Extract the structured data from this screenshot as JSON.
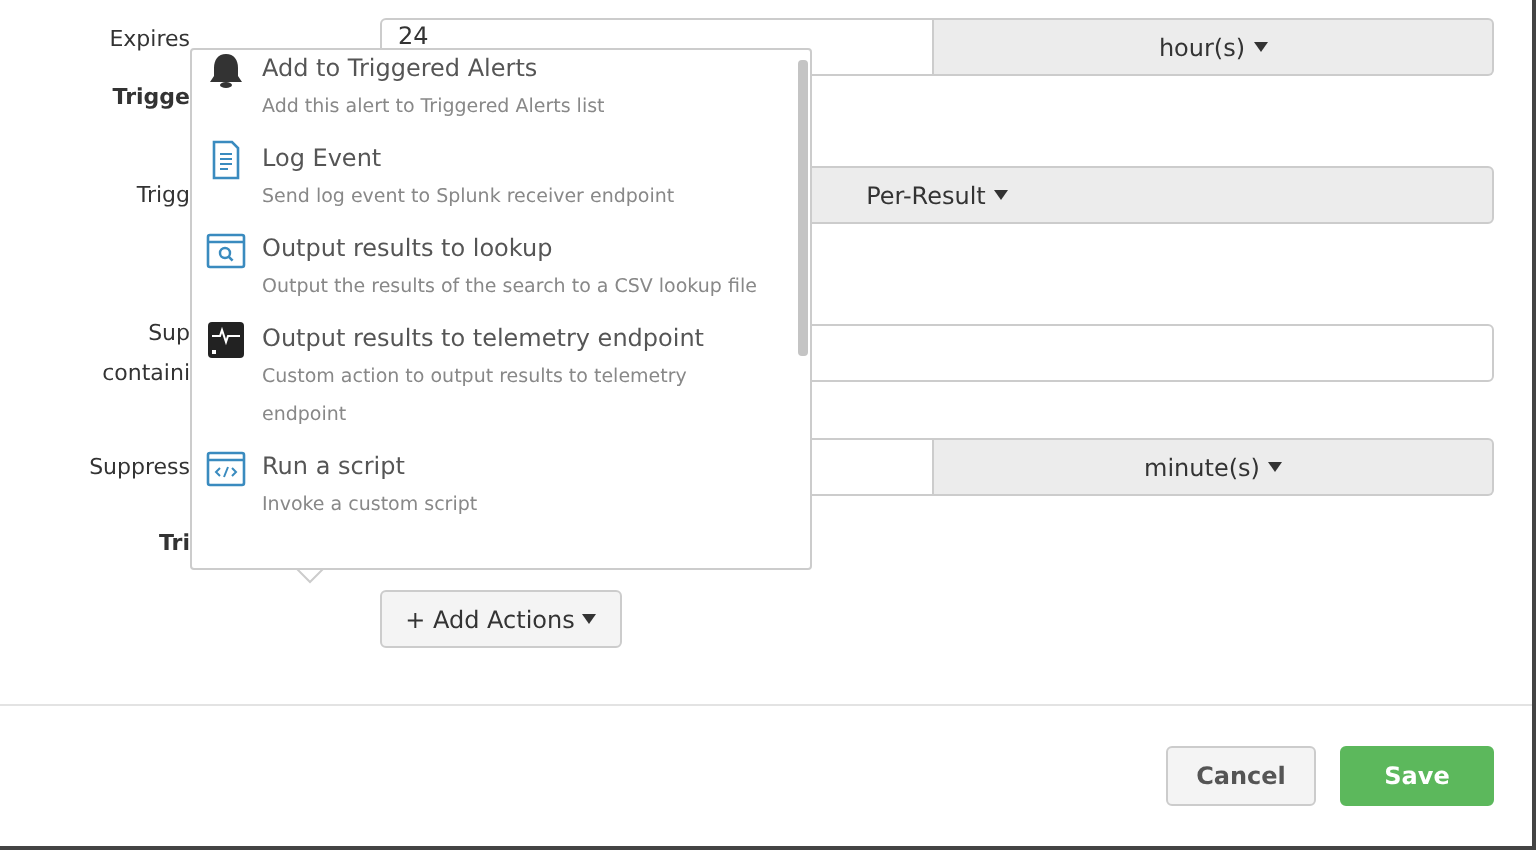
{
  "form": {
    "rows": [
      {
        "kind": "split",
        "label": "Expires",
        "value": "24",
        "unit": "hour(s)"
      },
      {
        "kind": "heading",
        "label": "Trigge"
      },
      {
        "kind": "select",
        "label": "Trigg",
        "value": "Per-Result"
      },
      {
        "kind": "input",
        "label": "Sup",
        "label_2": "containi"
      },
      {
        "kind": "split",
        "label": "Suppress",
        "unit": "minute(s)"
      },
      {
        "kind": "heading",
        "label": "Tri"
      }
    ],
    "add_button": "+ Add Actions"
  },
  "menu": {
    "items": [
      {
        "title": "Add to Triggered Alerts",
        "description": "Add this alert to Triggered Alerts list"
      },
      {
        "title": "Log Event",
        "description": "Send log event to Splunk receiver endpoint"
      },
      {
        "title": "Output results to lookup",
        "description": "Output the results of the search to a CSV lookup file"
      },
      {
        "title": "Output results to telemetry endpoint",
        "description": "Custom action to output results to telemetry endpoint"
      },
      {
        "title": "Run a script",
        "description": "Invoke a custom script"
      }
    ]
  },
  "footer": {
    "buttons": [
      {
        "label": "Cancel",
        "kind": "secondary"
      },
      {
        "label": "Save",
        "kind": "primary"
      }
    ]
  }
}
